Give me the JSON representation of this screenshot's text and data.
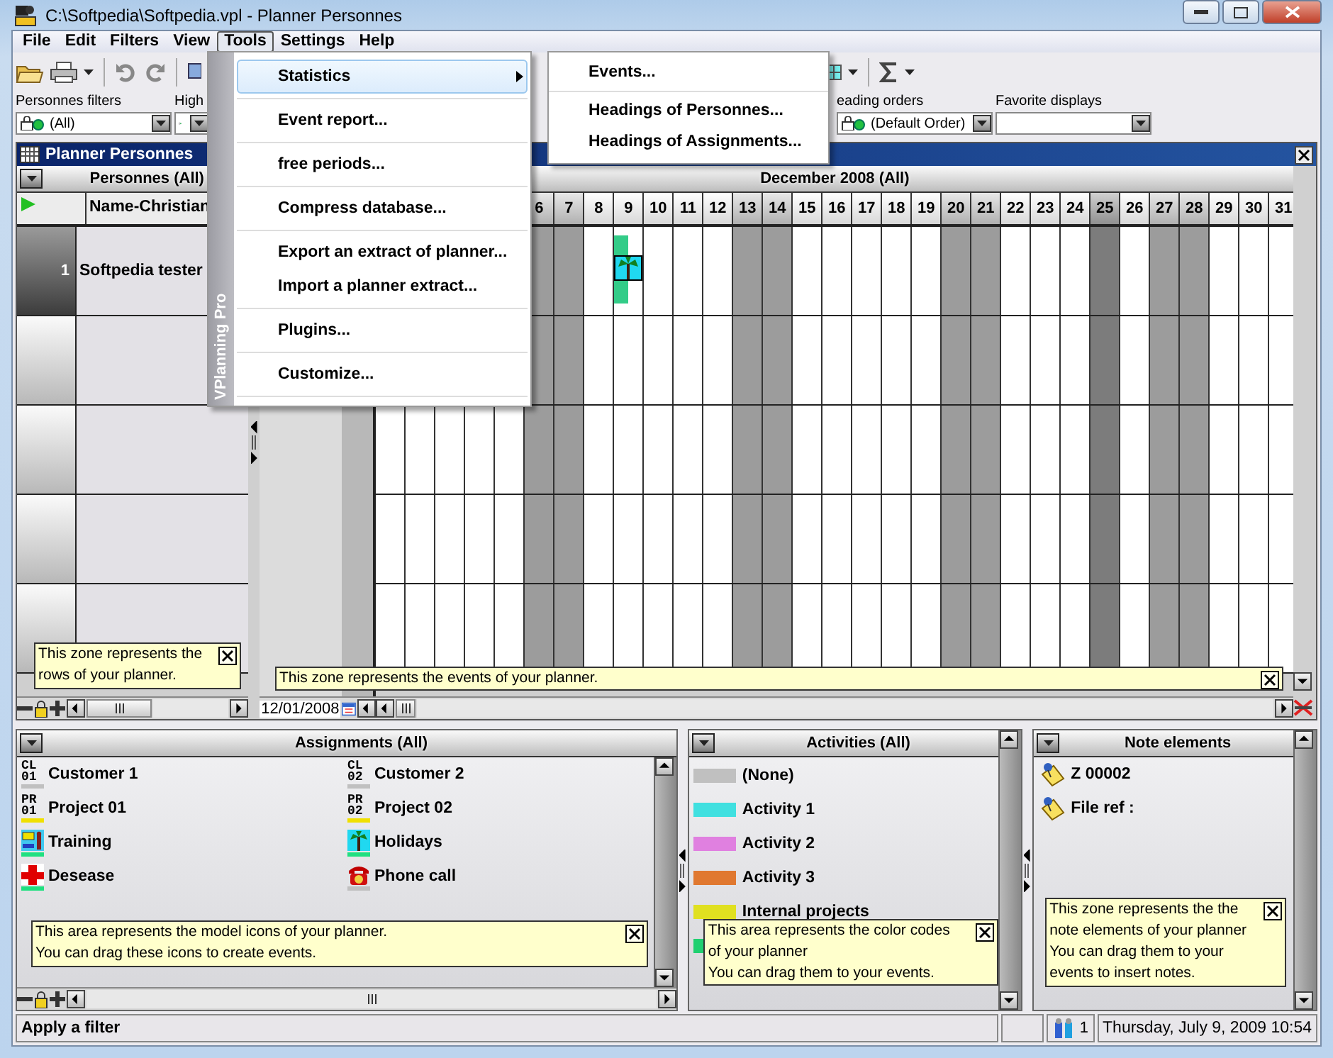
{
  "window": {
    "title": "C:\\Softpedia\\Softpedia.vpl - Planner Personnes"
  },
  "menu": [
    {
      "label": "File",
      "selected": false
    },
    {
      "label": "Edit",
      "selected": false
    },
    {
      "label": "Filters",
      "selected": false
    },
    {
      "label": "View",
      "selected": false
    },
    {
      "label": "Tools",
      "selected": true
    },
    {
      "label": "Settings",
      "selected": false
    },
    {
      "label": "Help",
      "selected": false
    }
  ],
  "filters": [
    {
      "label": "Personnes filters",
      "value": "(All)",
      "icon": true
    },
    {
      "label": "High",
      "icon": true
    },
    {
      "label": "eading orders",
      "value": "(Default Order)",
      "icon": true
    },
    {
      "label": "Favorite displays",
      "icon": false
    }
  ],
  "tools_menu": {
    "brand": "VPlanning Pro",
    "groups": [
      [
        {
          "label": "Statistics",
          "selected": true,
          "submenu": true
        }
      ],
      [
        {
          "label": "Event report...",
          "selected": false,
          "submenu": false
        }
      ],
      [
        {
          "label": "free periods...",
          "selected": false,
          "submenu": false
        }
      ],
      [
        {
          "label": "Compress database...",
          "selected": false,
          "submenu": false
        }
      ],
      [
        {
          "label": "Export an extract of planner...",
          "selected": false,
          "submenu": false
        },
        {
          "label": "Import a planner extract...",
          "selected": false,
          "submenu": false
        }
      ],
      [
        {
          "label": "Plugins...",
          "selected": false,
          "submenu": false
        }
      ],
      [
        {
          "label": "Customize...",
          "selected": false,
          "submenu": false
        }
      ]
    ],
    "submenu": [
      [
        {
          "label": "Events..."
        }
      ],
      [
        {
          "label": "Headings of Personnes..."
        },
        {
          "label": "Headings of Assignments..."
        }
      ]
    ]
  },
  "planner": {
    "title": "Planner Personnes",
    "rows_header": "Personnes (All)",
    "name_column": "Name-Christian",
    "month": "December 2008 (All)",
    "days": [
      {
        "label": "6",
        "kind": "weekend"
      },
      {
        "label": "7",
        "kind": "weekend"
      },
      {
        "label": "8",
        "kind": "weekday"
      },
      {
        "label": "9",
        "kind": "weekday",
        "event": {
          "kind": "palm"
        }
      },
      {
        "label": "10",
        "kind": "weekday"
      },
      {
        "label": "11",
        "kind": "weekday"
      },
      {
        "label": "12",
        "kind": "weekday"
      },
      {
        "label": "13",
        "kind": "weekend"
      },
      {
        "label": "14",
        "kind": "weekend"
      },
      {
        "label": "15",
        "kind": "weekday"
      },
      {
        "label": "16",
        "kind": "weekday"
      },
      {
        "label": "17",
        "kind": "weekday"
      },
      {
        "label": "18",
        "kind": "weekday"
      },
      {
        "label": "19",
        "kind": "weekday"
      },
      {
        "label": "20",
        "kind": "weekend"
      },
      {
        "label": "21",
        "kind": "weekend"
      },
      {
        "label": "22",
        "kind": "weekday"
      },
      {
        "label": "23",
        "kind": "weekday"
      },
      {
        "label": "24",
        "kind": "weekday"
      },
      {
        "label": "25",
        "kind": "holiday"
      },
      {
        "label": "26",
        "kind": "weekday"
      },
      {
        "label": "27",
        "kind": "weekend"
      },
      {
        "label": "28",
        "kind": "weekend"
      },
      {
        "label": "29",
        "kind": "weekday"
      },
      {
        "label": "30",
        "kind": "weekday"
      },
      {
        "label": "31",
        "kind": "weekday"
      }
    ],
    "rows": [
      {
        "number": "1",
        "name": "Softpedia tester",
        "selected": true
      }
    ],
    "date": "12/01/2008",
    "rows_tip": "This zone represents the\nrows of your planner.",
    "events_tip": "This zone represents the events of your planner."
  },
  "assignments": {
    "title": "Assignments (All)",
    "items": [
      {
        "label": "Customer 1",
        "kind": "code",
        "code": "CL\n01",
        "color": "#c0c0c0"
      },
      {
        "label": "Customer 2",
        "kind": "code",
        "code": "CL\n02",
        "color": "#c0c0c0"
      },
      {
        "label": "Project 01",
        "kind": "code",
        "code": "PR\n01",
        "color": "#f0e000"
      },
      {
        "label": "Project 02",
        "kind": "code",
        "code": "PR\n02",
        "color": "#f0e000"
      },
      {
        "label": "Training",
        "kind": "training",
        "color": "#20e080"
      },
      {
        "label": "Holidays",
        "kind": "palm",
        "color": "#20e080"
      },
      {
        "label": "Desease",
        "kind": "cross",
        "color": "#20e080"
      },
      {
        "label": "Phone call",
        "kind": "phone",
        "color": "#c0c0c0"
      }
    ],
    "tip": "This area represents the model icons of your planner.\nYou can drag these icons to create events."
  },
  "activities": {
    "title": "Activities (All)",
    "items": [
      {
        "label": "(None)",
        "color": "#c0c0c0"
      },
      {
        "label": "Activity 1",
        "color": "#40e0e0"
      },
      {
        "label": "Activity 2",
        "color": "#e080e0"
      },
      {
        "label": "Activity 3",
        "color": "#e07830"
      },
      {
        "label": "Internal projects",
        "color": "#e0e020"
      },
      {
        "color": "#20d070"
      }
    ],
    "tip": "This area represents the color codes\nof your planner\nYou can drag them to your events."
  },
  "notes": {
    "title": "Note elements",
    "items": [
      {
        "label": "Z 00002"
      },
      {
        "label": "File ref :"
      }
    ],
    "tip": "This zone represents the the\nnote elements of your planner\nYou can drag them to your\nevents to insert notes."
  },
  "status_bar": {
    "message": "Apply a filter",
    "count": "1",
    "datetime": "Thursday, July 9, 2009 10:54"
  }
}
